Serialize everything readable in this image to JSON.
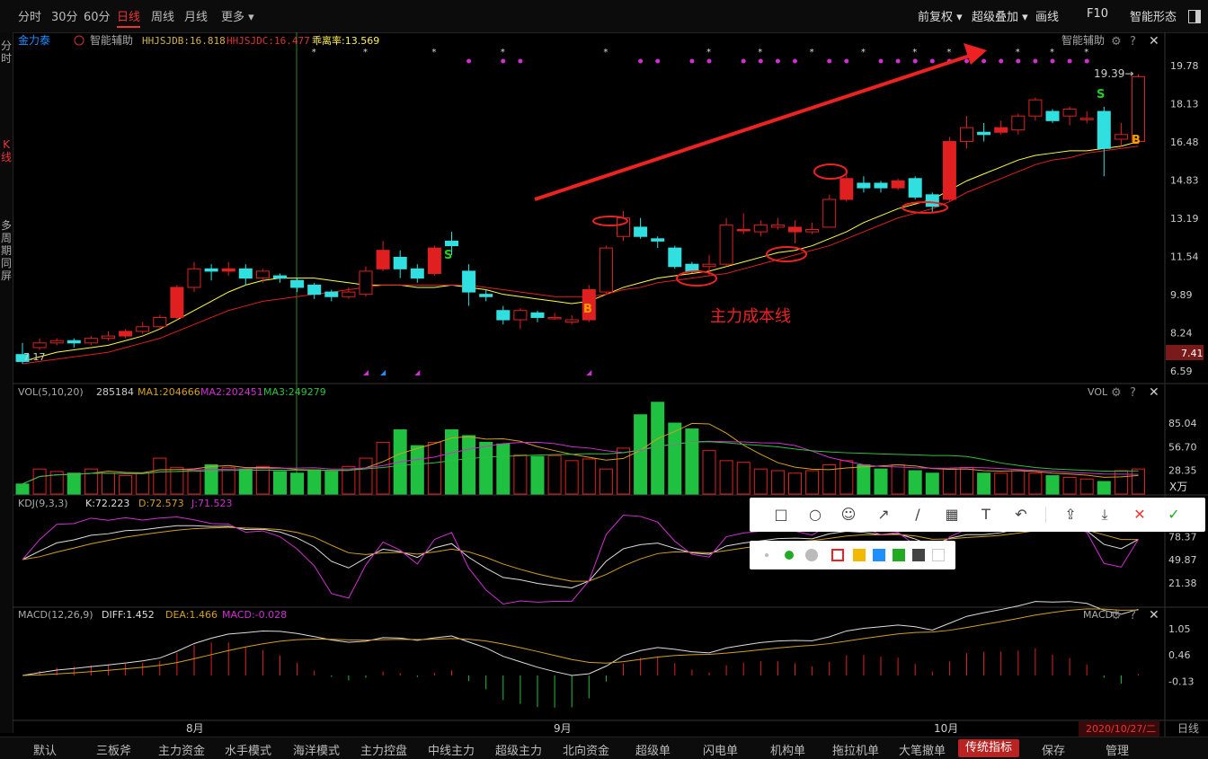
{
  "timeframes": [
    "分时",
    "30分",
    "60分",
    "日线",
    "周线",
    "月线",
    "更多 ▾"
  ],
  "active_timeframe": "日线",
  "top_right": {
    "adjust": "前复权 ▾",
    "overlay": "超级叠加 ▾",
    "draw": "画线",
    "f10": "F10",
    "smart": "智能形态"
  },
  "sidebar": {
    "item1": "分时",
    "item2": "K线",
    "item3": "多周期同屏"
  },
  "main_panel": {
    "stock": "金力泰",
    "assist": "智能辅助",
    "ind1": "HHJSJDB:16.818",
    "ind2": "HHJSJDC:16.477",
    "ind3": "乖离率:13.569",
    "panel_label": "智能辅助",
    "high_label": "19.39→",
    "low_label": "7.17",
    "annotation": "主力成本线",
    "price_badge": "7.41"
  },
  "vol_panel": {
    "name": "VOL(5,10,20)",
    "v": "285184",
    "ma1": "MA1:204666",
    "ma2": "MA2:202451",
    "ma3": "MA3:249279",
    "panel_label": "VOL",
    "unit": "X万"
  },
  "kdj_panel": {
    "name": "KDJ(9,3,3)",
    "k": "K:72.223",
    "d": "D:72.573",
    "j": "J:71.523"
  },
  "macd_panel": {
    "name": "MACD(12,26,9)",
    "diff": "DIFF:1.452",
    "dea": "DEA:1.466",
    "macd": "MACD:-0.028",
    "panel_label": "MACD"
  },
  "months": [
    "8月",
    "9月",
    "10月"
  ],
  "date_label": "2020/10/27/二",
  "period_label": "日线",
  "bottom_tabs": [
    "默认",
    "三板斧",
    "主力资金",
    "水手模式",
    "海洋模式",
    "主力控盘",
    "中线主力",
    "超级主力",
    "北向资金",
    "超级单",
    "闪电单",
    "机构单",
    "拖拉机单",
    "大笔撤单",
    "传统指标",
    "保存",
    "管理"
  ],
  "active_bottom_tab": "传统指标",
  "chart_data": {
    "type": "candlestick",
    "price_ticks": [
      19.78,
      18.13,
      16.48,
      14.83,
      13.19,
      11.54,
      9.89,
      8.24,
      6.59
    ],
    "vol_ticks": [
      85.04,
      56.7,
      28.35
    ],
    "kdj_ticks": [
      78.37,
      49.87,
      21.38
    ],
    "macd_ticks": [
      1.05,
      0.46,
      -0.13
    ],
    "candles": [
      [
        7.3,
        7.0,
        7.8,
        6.9
      ],
      [
        7.6,
        7.8,
        8.0,
        7.5
      ],
      [
        7.8,
        7.9,
        8.0,
        7.7
      ],
      [
        7.9,
        7.8,
        8.0,
        7.6
      ],
      [
        7.8,
        8.0,
        8.1,
        7.7
      ],
      [
        8.0,
        8.1,
        8.3,
        7.9
      ],
      [
        8.1,
        8.3,
        8.4,
        8.0
      ],
      [
        8.3,
        8.5,
        8.7,
        8.2
      ],
      [
        8.5,
        8.9,
        9.0,
        8.4
      ],
      [
        8.9,
        10.2,
        10.3,
        8.8
      ],
      [
        10.2,
        11.0,
        11.3,
        10.0
      ],
      [
        11.0,
        10.9,
        11.2,
        10.5
      ],
      [
        10.9,
        11.0,
        11.3,
        10.7
      ],
      [
        11.0,
        10.6,
        11.2,
        10.3
      ],
      [
        10.6,
        10.9,
        11.0,
        10.4
      ],
      [
        10.7,
        10.6,
        10.8,
        10.4
      ],
      [
        10.5,
        10.2,
        10.6,
        10.0
      ],
      [
        10.3,
        9.9,
        10.4,
        9.7
      ],
      [
        10.0,
        9.8,
        10.1,
        9.6
      ],
      [
        9.8,
        10.0,
        10.2,
        9.7
      ],
      [
        9.9,
        10.9,
        11.1,
        9.8
      ],
      [
        11.0,
        11.8,
        12.2,
        10.9
      ],
      [
        11.5,
        11.0,
        11.8,
        10.6
      ],
      [
        11.0,
        10.6,
        11.2,
        10.4
      ],
      [
        10.8,
        11.9,
        12.0,
        10.7
      ],
      [
        12.2,
        12.0,
        12.6,
        11.6
      ],
      [
        10.9,
        10.0,
        11.2,
        9.4
      ],
      [
        9.9,
        9.8,
        10.1,
        9.6
      ],
      [
        9.2,
        8.8,
        9.4,
        8.6
      ],
      [
        8.8,
        9.2,
        9.3,
        8.4
      ],
      [
        9.1,
        8.9,
        9.2,
        8.7
      ],
      [
        8.9,
        8.9,
        9.1,
        8.8
      ],
      [
        8.7,
        8.8,
        9.0,
        8.6
      ],
      [
        8.8,
        10.1,
        10.3,
        8.7
      ],
      [
        10.0,
        11.9,
        12.0,
        9.9
      ],
      [
        12.4,
        13.2,
        13.5,
        12.2
      ],
      [
        12.8,
        12.4,
        13.2,
        12.3
      ],
      [
        12.3,
        12.2,
        12.4,
        11.9
      ],
      [
        11.9,
        11.1,
        12.0,
        11.0
      ],
      [
        11.2,
        10.9,
        11.3,
        10.8
      ],
      [
        11.1,
        11.2,
        11.6,
        10.7
      ],
      [
        11.2,
        12.9,
        13.2,
        11.1
      ],
      [
        12.7,
        12.7,
        13.4,
        12.5
      ],
      [
        12.6,
        12.9,
        13.1,
        12.4
      ],
      [
        12.8,
        12.9,
        13.2,
        12.7
      ],
      [
        12.6,
        12.8,
        13.1,
        12.1
      ],
      [
        12.6,
        12.7,
        13.0,
        12.5
      ],
      [
        12.8,
        14.0,
        14.2,
        12.8
      ],
      [
        14.0,
        14.9,
        15.3,
        13.9
      ],
      [
        14.7,
        14.5,
        15.0,
        14.3
      ],
      [
        14.7,
        14.5,
        14.8,
        14.3
      ],
      [
        14.5,
        14.8,
        14.9,
        14.4
      ],
      [
        14.9,
        14.1,
        15.0,
        14.0
      ],
      [
        14.2,
        13.7,
        14.3,
        13.4
      ],
      [
        14.0,
        16.5,
        16.7,
        13.9
      ],
      [
        16.5,
        17.1,
        17.6,
        16.2
      ],
      [
        16.9,
        16.8,
        17.3,
        16.5
      ],
      [
        16.9,
        17.1,
        17.4,
        16.8
      ],
      [
        17.0,
        17.6,
        17.7,
        16.8
      ],
      [
        17.6,
        18.3,
        18.4,
        17.4
      ],
      [
        17.8,
        17.4,
        17.9,
        17.3
      ],
      [
        17.6,
        17.9,
        18.0,
        17.2
      ],
      [
        17.5,
        17.5,
        17.8,
        17.3
      ],
      [
        17.8,
        16.2,
        18.0,
        15.0
      ],
      [
        16.6,
        16.8,
        17.3,
        16.3
      ],
      [
        16.5,
        19.3,
        19.4,
        16.4
      ]
    ],
    "volumes": [
      12,
      30,
      27,
      25,
      30,
      25,
      22,
      25,
      43,
      32,
      29,
      35,
      32,
      30,
      33,
      27,
      25,
      29,
      27,
      33,
      43,
      62,
      77,
      58,
      62,
      77,
      70,
      62,
      60,
      47,
      45,
      46,
      40,
      42,
      30,
      55,
      95,
      110,
      85,
      78,
      52,
      40,
      38,
      30,
      28,
      25,
      28,
      35,
      40,
      35,
      30,
      35,
      28,
      25,
      30,
      32,
      25,
      25,
      28,
      25,
      22,
      20,
      18,
      15,
      28,
      30
    ],
    "ma5": [
      7.0,
      7.2,
      7.4,
      7.5,
      7.6,
      7.7,
      7.9,
      8.1,
      8.4,
      8.8,
      9.2,
      9.6,
      10.0,
      10.3,
      10.5,
      10.6,
      10.6,
      10.6,
      10.5,
      10.4,
      10.3,
      10.3,
      10.3,
      10.2,
      10.2,
      10.3,
      10.2,
      10.1,
      9.9,
      9.8,
      9.7,
      9.6,
      9.5,
      9.6,
      9.9,
      10.2,
      10.4,
      10.6,
      10.7,
      10.8,
      10.9,
      11.1,
      11.3,
      11.5,
      11.7,
      11.8,
      12.0,
      12.3,
      12.6,
      13.0,
      13.3,
      13.6,
      13.8,
      14.0,
      14.4,
      14.8,
      15.1,
      15.4,
      15.7,
      15.9,
      16.0,
      16.1,
      16.1,
      16.2,
      16.3,
      16.5
    ],
    "ma10": [
      6.9,
      7.0,
      7.1,
      7.2,
      7.3,
      7.4,
      7.6,
      7.8,
      8.0,
      8.3,
      8.6,
      8.9,
      9.2,
      9.4,
      9.6,
      9.7,
      9.8,
      9.9,
      10.0,
      10.1,
      10.2,
      10.3,
      10.3,
      10.3,
      10.3,
      10.3,
      10.3,
      10.2,
      10.1,
      10.0,
      9.9,
      9.8,
      9.8,
      9.8,
      9.9,
      10.1,
      10.2,
      10.4,
      10.5,
      10.6,
      10.7,
      10.8,
      11.0,
      11.2,
      11.4,
      11.6,
      11.8,
      12.0,
      12.3,
      12.6,
      12.9,
      13.2,
      13.4,
      13.6,
      13.9,
      14.3,
      14.6,
      14.9,
      15.2,
      15.5,
      15.7,
      15.8,
      16.0,
      16.1,
      16.2,
      16.3
    ]
  }
}
